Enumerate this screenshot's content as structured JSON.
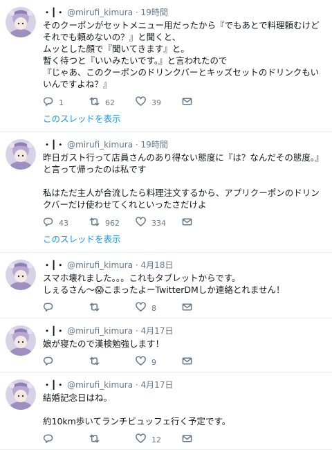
{
  "tweets": [
    {
      "name": "・┃・",
      "handle": "@mirufi_kimura",
      "sep": "·",
      "time": "19時間",
      "lines": [
        "そのクーポンがセットメニュー用だったから『でもあとで料理頼むけどそれでも頼めないの？』と聞くと、",
        "ムッとした顔で『聞いてきます』と。",
        "暫く待つと『いいみたいです。』と言われたので",
        "『じゃあ、このクーポンのドリンクバーとキッズセットのドリンクもいいんですよね？』"
      ],
      "reply": "1",
      "retweet": "62",
      "like": "39",
      "thread": "このスレッドを表示"
    },
    {
      "name": "・┃・",
      "handle": "@mirufi_kimura",
      "sep": "·",
      "time": "19時間",
      "lines": [
        "昨日ガスト行って店員さんのあり得ない態度に『は？なんだその態度。』と言って帰ったのは私です",
        "",
        "私はただ主人が合流したら料理注文するから、アプリクーポンのドリンクバーだけ使わせてくれといったさだけよ"
      ],
      "reply": "43",
      "retweet": "962",
      "like": "334",
      "thread": "このスレッドを表示"
    },
    {
      "name": "・┃・",
      "handle": "@mirufi_kimura",
      "sep": "·",
      "time": "4月18日",
      "lines": [
        "スマホ壊れました。。。これもタブレットからです。",
        "しぇるさん〜😱こまったよーTwitterDMしか連絡とれません！"
      ],
      "reply": "",
      "retweet": "",
      "like": "8",
      "thread": ""
    },
    {
      "name": "・┃・",
      "handle": "@mirufi_kimura",
      "sep": "·",
      "time": "4月17日",
      "lines": [
        "娘が寝たので漢検勉強します！"
      ],
      "reply": "",
      "retweet": "",
      "like": "9",
      "thread": ""
    },
    {
      "name": "・┃・",
      "handle": "@mirufi_kimura",
      "sep": "·",
      "time": "4月17日",
      "lines": [
        "結婚記念日はね。",
        "",
        "約10km歩いてランチビュッフェ行く予定です。"
      ],
      "reply": "",
      "retweet": "",
      "like": "12",
      "thread": ""
    }
  ],
  "colors": {
    "link": "#1b95e0",
    "gray": "#657786",
    "border": "#e6ecf0"
  },
  "icons": [
    "reply-icon",
    "retweet-icon",
    "like-icon",
    "mail-icon"
  ]
}
